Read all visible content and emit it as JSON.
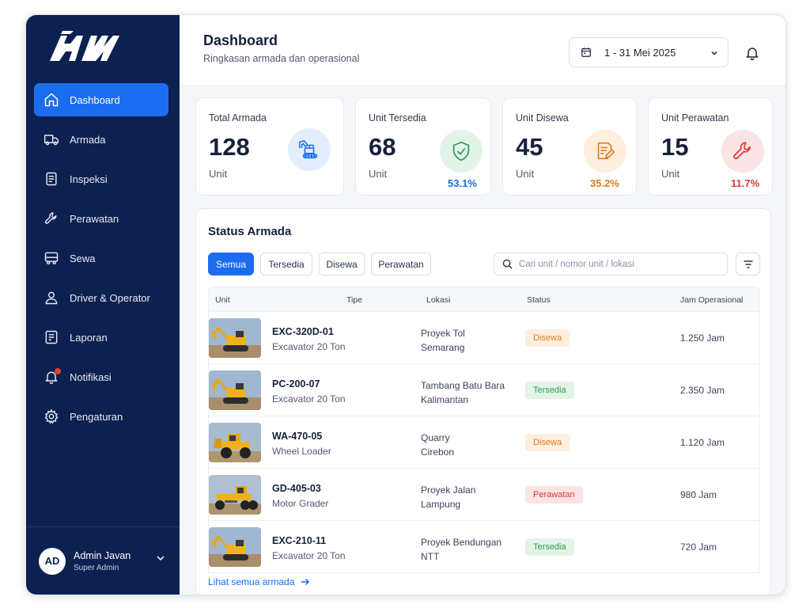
{
  "colors": {
    "sidebar_bg": "#0d2150",
    "accent": "#1c6cf0",
    "available": "#2e9a52",
    "rented": "#e07a1e",
    "maintenance": "#d93b3b"
  },
  "sidebar": {
    "items": [
      {
        "label": "Dashboard",
        "icon": "home-icon",
        "active": true
      },
      {
        "label": "Armada",
        "icon": "truck-icon"
      },
      {
        "label": "Inspeksi",
        "icon": "checklist-icon"
      },
      {
        "label": "Perawatan",
        "icon": "wrench-icon"
      },
      {
        "label": "Sewa",
        "icon": "van-icon"
      },
      {
        "label": "Driver & Operator",
        "icon": "user-icon"
      },
      {
        "label": "Laporan",
        "icon": "report-icon"
      },
      {
        "label": "Notifikasi",
        "icon": "bell-icon"
      },
      {
        "label": "Pengaturan",
        "icon": "gear-icon"
      }
    ],
    "user": {
      "initials": "AD",
      "name": "Admin Javan",
      "role": "Super Admin"
    }
  },
  "header": {
    "title": "Dashboard",
    "subtitle": "Ringkasan armada dan operasional",
    "date_range": "1 - 31 Mei 2025"
  },
  "stats": [
    {
      "label": "Total Armada",
      "value": "128",
      "unit": "Unit",
      "pct": "",
      "icon": "excavator-icon"
    },
    {
      "label": "Unit Tersedia",
      "value": "68",
      "unit": "Unit",
      "pct": "53.1%",
      "icon": "shield-check-icon"
    },
    {
      "label": "Unit Disewa",
      "value": "45",
      "unit": "Unit",
      "pct": "35.2%",
      "icon": "document-pen-icon"
    },
    {
      "label": "Unit Perawatan",
      "value": "15",
      "unit": "Unit",
      "pct": "11.7%",
      "icon": "wrench-icon"
    }
  ],
  "status_panel": {
    "title": "Status Armada",
    "tabs": [
      "Semua",
      "Tersedia",
      "Disewa",
      "Perawatan"
    ],
    "search_placeholder": "Cari unit / nomor unit / lokasi",
    "columns": [
      "Unit",
      "Tipe",
      "Lokasi",
      "Status",
      "Jam Operasional"
    ],
    "rows": [
      {
        "code": "EXC-320D-01",
        "type": "Excavator 20 Ton",
        "loc1": "Proyek Tol",
        "loc2": "Semarang",
        "status": "Disewa",
        "hours": "1.250 Jam",
        "img": "excavator"
      },
      {
        "code": "PC-200-07",
        "type": "Excavator 20 Ton",
        "loc1": "Tambang Batu Bara",
        "loc2": "Kalimantan",
        "status": "Tersedia",
        "hours": "2.350 Jam",
        "img": "excavator"
      },
      {
        "code": "WA-470-05",
        "type": "Wheel Loader",
        "loc1": "Quarry",
        "loc2": "Cirebon",
        "status": "Disewa",
        "hours": "1.120 Jam",
        "img": "loader"
      },
      {
        "code": "GD-405-03",
        "type": "Motor Grader",
        "loc1": "Proyek Jalan",
        "loc2": "Lampung",
        "status": "Perawatan",
        "hours": "980 Jam",
        "img": "grader"
      },
      {
        "code": "EXC-210-11",
        "type": "Excavator 20 Ton",
        "loc1": "Proyek Bendungan",
        "loc2": "NTT",
        "status": "Tersedia",
        "hours": "720 Jam",
        "img": "excavator"
      }
    ],
    "see_all": "Lihat semua armada"
  }
}
